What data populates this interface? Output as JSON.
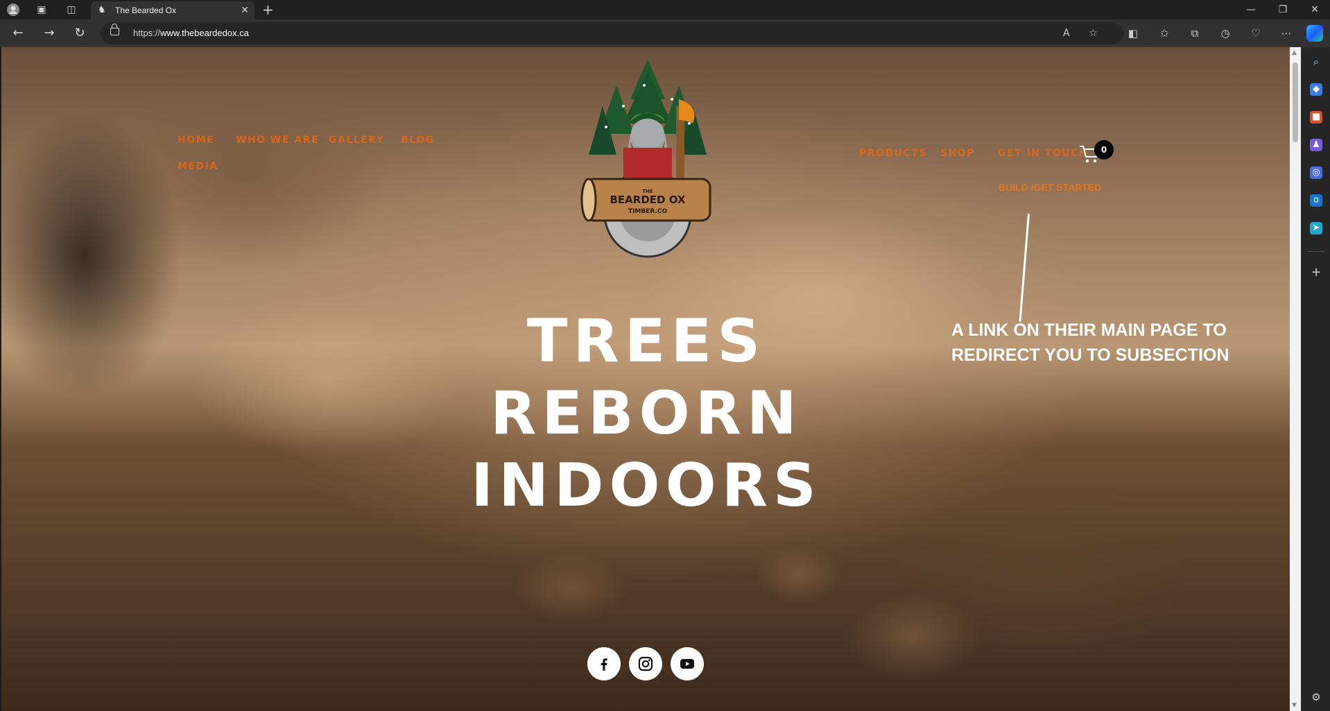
{
  "browser": {
    "tab_title": "The Bearded Ox",
    "url_scheme": "https://",
    "url_host": "www.thebeardedox.ca"
  },
  "site": {
    "nav_left": [
      "HOME",
      "WHO WE ARE",
      "GALLERY",
      "BLOG",
      "MEDIA"
    ],
    "nav_right": [
      "PRODUCTS",
      "SHOP",
      "GET IN TOUCH"
    ],
    "nav_sub": "BUILD /GET STARTED",
    "cart_count": "0",
    "logo_text_1": "THE",
    "logo_text_2": "BEARDED OX",
    "logo_text_3": "TIMBER.CO",
    "hero_line_1": "TREES REBORN",
    "hero_line_2": "INDOORS",
    "annotation_line_1": "A LINK ON THEIR MAIN PAGE TO",
    "annotation_line_2": "REDIRECT YOU TO SUBSECTION",
    "social": [
      "facebook-icon",
      "instagram-icon",
      "youtube-icon"
    ]
  },
  "colors": {
    "nav": "#d9661b",
    "browser_bg": "#202020"
  }
}
